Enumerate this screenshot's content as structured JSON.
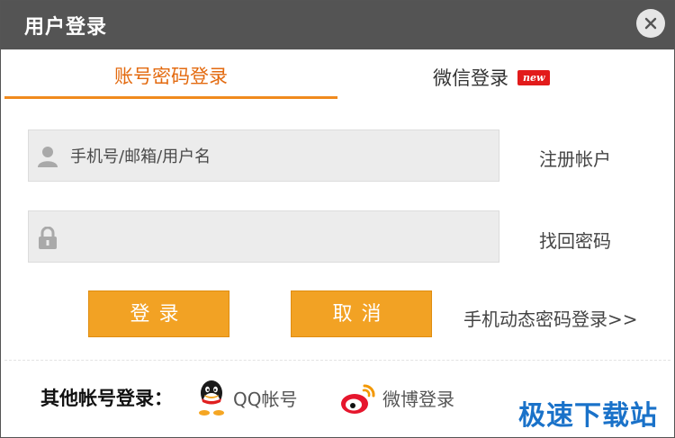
{
  "window": {
    "title": "用户登录",
    "close_icon": "close-icon"
  },
  "tabs": {
    "account": "账号密码登录",
    "wechat": "微信登录",
    "wechat_badge": "new"
  },
  "form": {
    "username_placeholder": "手机号/邮箱/用户名",
    "username_value": "",
    "password_value": "",
    "username_icon": "user-icon",
    "password_icon": "lock-icon"
  },
  "links": {
    "register": "注册帐户",
    "forgot": "找回密码",
    "mobile_login": "手机动态密码登录>>"
  },
  "buttons": {
    "login": "登录",
    "cancel": "取消"
  },
  "other_login": {
    "label": "其他帐号登录：",
    "qq": "QQ帐号",
    "weibo": "微博登录"
  },
  "watermark": "极速下载站",
  "colors": {
    "titlebar": "#545454",
    "accent": "#f2a224",
    "tab_active": "#e36a0f",
    "badge": "#e21b1b",
    "watermark": "#1a72c9"
  }
}
